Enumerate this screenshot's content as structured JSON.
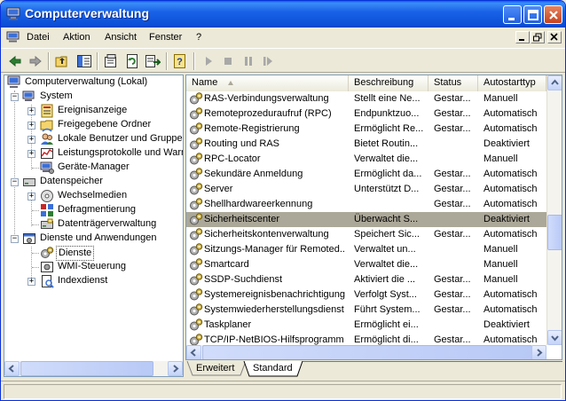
{
  "window": {
    "title": "Computerverwaltung"
  },
  "menu": {
    "items": [
      "Datei",
      "Aktion",
      "Ansicht",
      "Fenster",
      "?"
    ]
  },
  "tree": {
    "root": "Computerverwaltung (Lokal)",
    "system": "System",
    "ereignisanzeige": "Ereignisanzeige",
    "freigegebene": "Freigegebene Ordner",
    "lokale": "Lokale Benutzer und Gruppen",
    "leistung": "Leistungsprotokolle und Warnungen",
    "geraete": "Geräte-Manager",
    "datenspeicher": "Datenspeicher",
    "wechselmedien": "Wechselmedien",
    "defrag": "Defragmentierung",
    "datentraeger": "Datenträgerverwaltung",
    "dienste_anw": "Dienste und Anwendungen",
    "dienste": "Dienste",
    "wmi": "WMI-Steuerung",
    "index": "Indexdienst"
  },
  "list": {
    "columns": [
      "Name",
      "Beschreibung",
      "Status",
      "Autostarttyp"
    ],
    "rows": [
      [
        "RAS-Verbindungsverwaltung",
        "Stellt eine Ne...",
        "Gestar...",
        "Manuell"
      ],
      [
        "Remoteprozeduraufruf (RPC)",
        "Endpunktzuo...",
        "Gestar...",
        "Automatisch"
      ],
      [
        "Remote-Registrierung",
        "Ermöglicht Re...",
        "Gestar...",
        "Automatisch"
      ],
      [
        "Routing und RAS",
        "Bietet Routin...",
        "",
        "Deaktiviert"
      ],
      [
        "RPC-Locator",
        "Verwaltet die...",
        "",
        "Manuell"
      ],
      [
        "Sekundäre Anmeldung",
        "Ermöglicht da...",
        "Gestar...",
        "Automatisch"
      ],
      [
        "Server",
        "Unterstützt D...",
        "Gestar...",
        "Automatisch"
      ],
      [
        "Shellhardwareerkennung",
        "",
        "Gestar...",
        "Automatisch"
      ],
      [
        "Sicherheitscenter",
        "Überwacht S...",
        "",
        "Deaktiviert"
      ],
      [
        "Sicherheitskontenverwaltung",
        "Speichert Sic...",
        "Gestar...",
        "Automatisch"
      ],
      [
        "Sitzungs-Manager für Remoted...",
        "Verwaltet un...",
        "",
        "Manuell"
      ],
      [
        "Smartcard",
        "Verwaltet die...",
        "",
        "Manuell"
      ],
      [
        "SSDP-Suchdienst",
        "Aktiviert die ...",
        "Gestar...",
        "Manuell"
      ],
      [
        "Systemereignisbenachrichtigung",
        "Verfolgt Syst...",
        "Gestar...",
        "Automatisch"
      ],
      [
        "Systemwiederherstellungsdienst",
        "Führt System...",
        "Gestar...",
        "Automatisch"
      ],
      [
        "Taskplaner",
        "Ermöglicht ei...",
        "",
        "Deaktiviert"
      ],
      [
        "TCP/IP-NetBIOS-Hilfsprogramm",
        "Ermöglicht di...",
        "Gestar...",
        "Automatisch"
      ]
    ]
  },
  "tabs": [
    "Erweitert",
    "Standard"
  ],
  "colors": {
    "title_bar": "#0A5FE8",
    "selection": "#ACA899",
    "window_bg": "#ECE9D8"
  },
  "icons": [
    "computer-management-icon",
    "back-arrow-icon",
    "forward-arrow-icon",
    "up-folder-icon",
    "show-hide-tree-icon",
    "properties-icon",
    "refresh-icon",
    "export-list-icon",
    "help-icon",
    "play-icon",
    "stop-icon",
    "pause-icon",
    "restart-icon",
    "gear-icon"
  ]
}
